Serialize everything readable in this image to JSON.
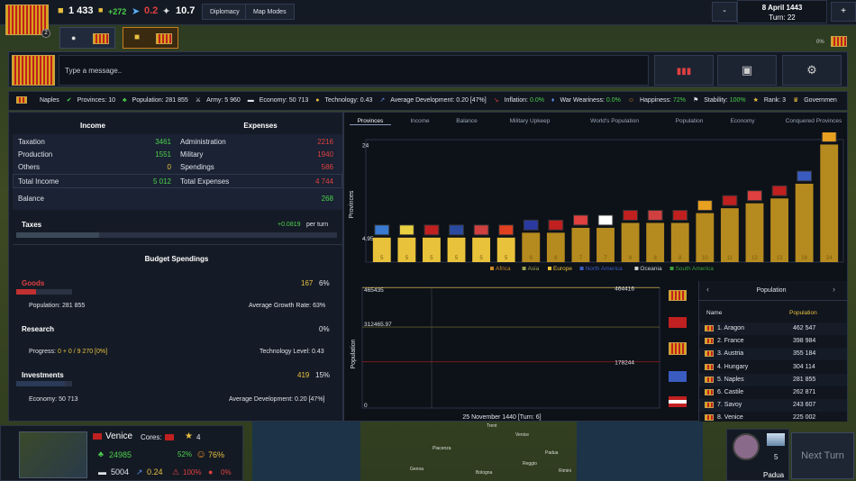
{
  "topbar": {
    "gold": "1 433",
    "income": "+272",
    "manpower": "0.2",
    "prestige": "10.7",
    "diplomacy_label": "Diplomacy",
    "map_modes_label": "Map Modes",
    "date": "8 April 1443",
    "turn": "Turn: 22",
    "minus": "-",
    "plus": "+",
    "badge": "2",
    "pct": "0%"
  },
  "chat": {
    "placeholder": "Type a message.."
  },
  "stats": {
    "country": "Naples",
    "provinces": "Provinces: 10",
    "population": "Population: 281 855",
    "army": "Army: 5 960",
    "economy": "Economy: 50 713",
    "technology": "Technology: 0.43",
    "avg_dev": "Average Development: 0.20 [47%]",
    "inflation_label": "Inflation:",
    "inflation": "0.0%",
    "war_label": "War Weariness:",
    "war": "0.0%",
    "happiness_label": "Happiness:",
    "happiness": "72%",
    "stability_label": "Stability:",
    "stability": "100%",
    "rank": "Rank: 3",
    "government": "Governmen"
  },
  "budget": {
    "income_header": "Income",
    "expenses_header": "Expenses",
    "income_rows": [
      {
        "label": "Taxation",
        "value": "3461"
      },
      {
        "label": "Production",
        "value": "1551"
      },
      {
        "label": "Others",
        "value": "0"
      }
    ],
    "expense_rows": [
      {
        "label": "Administration",
        "value": "2216"
      },
      {
        "label": "Military",
        "value": "1940"
      },
      {
        "label": "Spendings",
        "value": "586"
      }
    ],
    "total_income_label": "Total Income",
    "total_income": "5 012",
    "total_expenses_label": "Total Expenses",
    "total_expenses": "4 744",
    "balance_label": "Balance",
    "balance": "268",
    "taxes_label": "Taxes",
    "taxes_rate": "+0.0819",
    "taxes_suffix": "per turn",
    "spendings_header": "Budget Spendings",
    "goods_label": "Goods",
    "goods_value": "167",
    "goods_pct": "6%",
    "goods_pop": "Population: 281 855",
    "goods_growth": "Average Growth Rate: 63%",
    "research_label": "Research",
    "research_pct": "0%",
    "research_progress_label": "Progress:",
    "research_progress": "0 + 0 / 9 270 [0%]",
    "research_tech": "Technology Level: 0.43",
    "investments_label": "Investments",
    "investments_value": "419",
    "investments_pct": "15%",
    "investments_economy": "Economy: 50 713",
    "investments_dev": "Average Development: 0.20 [47%]"
  },
  "chart_tabs": [
    "Provinces",
    "Income",
    "Balance",
    "Military Upkeep",
    "World's Population",
    "Population",
    "Economy",
    "Conquered Provinces"
  ],
  "chart_data": [
    {
      "type": "bar",
      "title": "",
      "ylabel": "Provinces",
      "y_ticks": [
        "24",
        "4.95"
      ],
      "values": [
        5,
        5,
        5,
        5,
        5,
        5,
        6,
        6,
        7,
        7,
        8,
        8,
        8,
        10,
        11,
        12,
        13,
        16,
        24
      ],
      "legend": [
        {
          "name": "Africa",
          "color": "#c8892a"
        },
        {
          "name": "Asia",
          "color": "#9aa050"
        },
        {
          "name": "Europe",
          "color": "#e8c23a"
        },
        {
          "name": "North America",
          "color": "#3a5cc0"
        },
        {
          "name": "Oceania",
          "color": "#d0d0d0"
        },
        {
          "name": "South America",
          "color": "#3aa03a"
        }
      ]
    },
    {
      "type": "line",
      "ylabel": "Population",
      "y_ticks": [
        "465435",
        "312465.97",
        "0"
      ],
      "labels": [
        "464416",
        "178244"
      ],
      "xlabel": "25 November 1440 [Turn: 6]"
    }
  ],
  "pop_table": {
    "title": "Population",
    "col_name": "Name",
    "col_pop": "Population",
    "prev": "‹",
    "next": "›",
    "rows": [
      {
        "name": "1. Aragon",
        "value": "462 547"
      },
      {
        "name": "2. France",
        "value": "398 984"
      },
      {
        "name": "3. Austria",
        "value": "355 184"
      },
      {
        "name": "4. Hungary",
        "value": "304 114"
      },
      {
        "name": "5. Naples",
        "value": "281 855"
      },
      {
        "name": "6. Castile",
        "value": "262 871"
      },
      {
        "name": "7. Savoy",
        "value": "243 607"
      },
      {
        "name": "8. Venice",
        "value": "225 002"
      }
    ]
  },
  "bottom": {
    "province": "Venice",
    "cores_label": "Cores:",
    "stars": "4",
    "population": "24985",
    "pct1": "52%",
    "happy": "76%",
    "money": "5004",
    "dev": "0.24",
    "pct2": "100%",
    "pct3": "0%",
    "unit_count": "5",
    "city": "Padua",
    "next_turn": "Next Turn"
  },
  "map_labels": [
    "Piacenza",
    "Venice",
    "Trent",
    "Padua",
    "Bologna",
    "Genoa",
    "Rimini",
    "Reggio"
  ]
}
